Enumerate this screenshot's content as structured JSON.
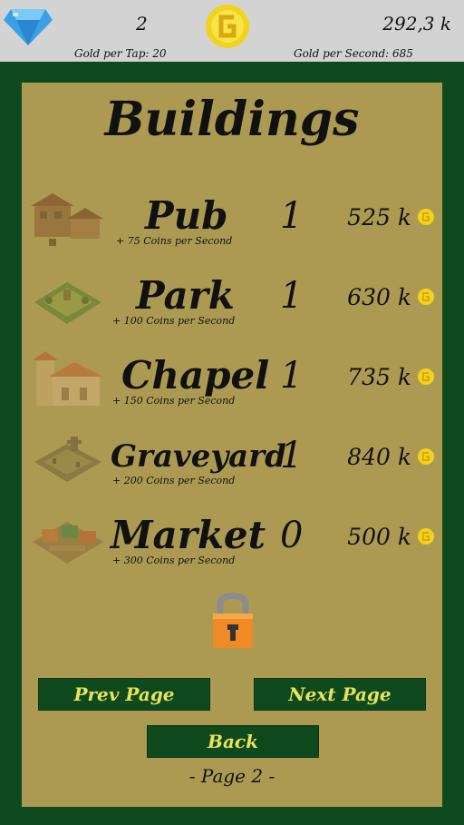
{
  "header": {
    "gems": "2",
    "gold_total": "292,3 k",
    "gold_per_tap": "Gold per Tap: 20",
    "gold_per_second": "Gold per Second: 685"
  },
  "panel": {
    "title": "Buildings",
    "buildings": [
      {
        "name": "Pub",
        "desc": "+ 75 Coins per Second",
        "count": "1",
        "price": "525 k",
        "icon": "pub-building-icon"
      },
      {
        "name": "Park",
        "desc": "+ 100 Coins per Second",
        "count": "1",
        "price": "630 k",
        "icon": "park-building-icon"
      },
      {
        "name": "Chapel",
        "desc": "+ 150 Coins per Second",
        "count": "1",
        "price": "735 k",
        "icon": "chapel-building-icon"
      },
      {
        "name": "Graveyard",
        "desc": "+ 200 Coins per Second",
        "count": "1",
        "price": "840 k",
        "icon": "graveyard-building-icon"
      },
      {
        "name": "Market",
        "desc": "+ 300 Coins per Second",
        "count": "0",
        "price": "500 k",
        "icon": "market-building-icon"
      }
    ],
    "prev_label": "Prev Page",
    "next_label": "Next Page",
    "back_label": "Back",
    "page_label": "- Page 2 -"
  },
  "colors": {
    "frame": "#0f4a1e",
    "panel": "#ad9a52",
    "topbar": "#d3d3d3",
    "button_text": "#e8e35a",
    "coin": "#f2d21a"
  }
}
